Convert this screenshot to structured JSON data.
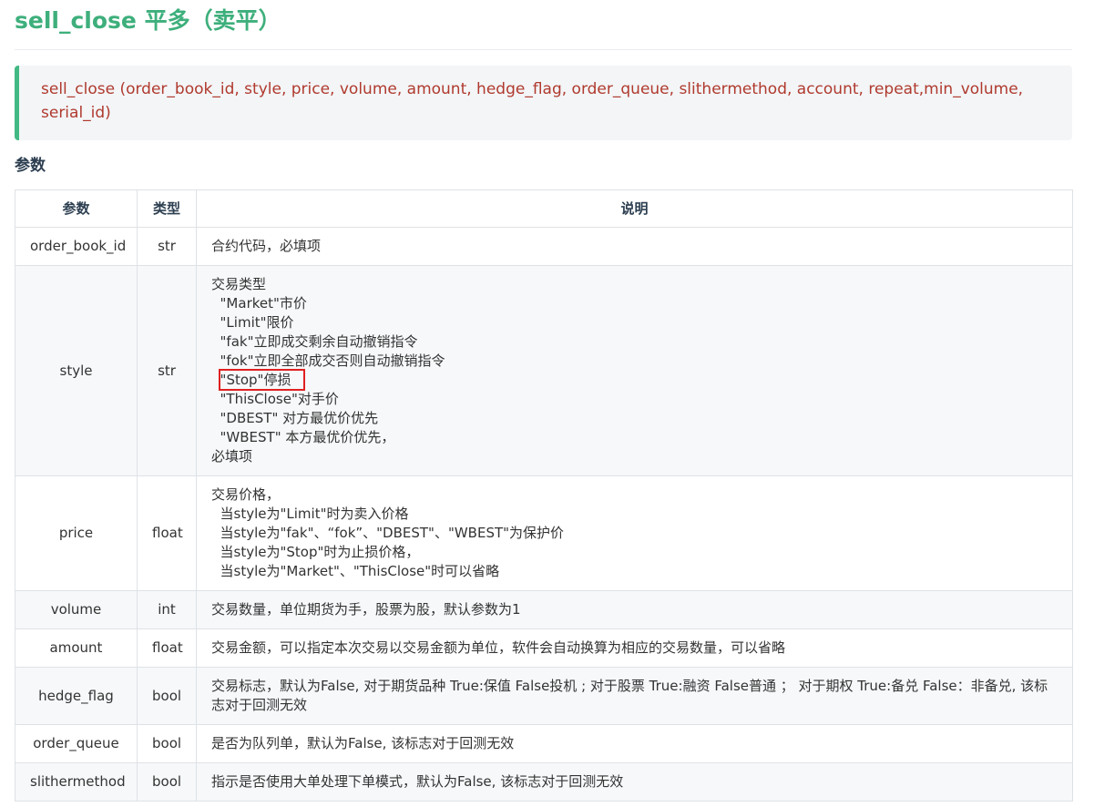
{
  "title": "sell_close 平多（卖平）",
  "signature": "sell_close (order_book_id, style, price, volume, amount, hedge_flag, order_queue, slithermethod, account, repeat,min_volume, serial_id)",
  "params_heading": "参数",
  "table": {
    "headers": [
      "参数",
      "类型",
      "说明"
    ],
    "rows": [
      {
        "name": "order_book_id",
        "type": "str",
        "desc": [
          "合约代码，必填项"
        ]
      },
      {
        "name": "style",
        "type": "str",
        "desc": [
          "交易类型",
          "  \"Market\"市价",
          "  \"Limit\"限价",
          "  \"fak\"立即成交剩余自动撤销指令",
          "  \"fok\"立即全部成交否则自动撤销指令",
          "  \"Stop\"停损",
          "  \"ThisClose\"对手价",
          "  \"DBEST\" 对方最优价优先",
          "  \"WBEST\" 本方最优价优先，",
          "必填项"
        ]
      },
      {
        "name": "price",
        "type": "float",
        "desc": [
          "交易价格，",
          "  当style为\"Limit\"时为卖入价格",
          "  当style为\"fak\"、“fok”、\"DBEST\"、\"WBEST\"为保护价",
          "  当style为\"Stop\"时为止损价格，",
          "  当style为\"Market\"、\"ThisClose\"时可以省略"
        ]
      },
      {
        "name": "volume",
        "type": "int",
        "desc": [
          "交易数量，单位期货为手，股票为股，默认参数为1"
        ]
      },
      {
        "name": "amount",
        "type": "float",
        "desc": [
          "交易金额，可以指定本次交易以交易金额为单位，软件会自动换算为相应的交易数量，可以省略"
        ]
      },
      {
        "name": "hedge_flag",
        "type": "bool",
        "desc": [
          "交易标志，默认为False, 对于期货品种 True:保值 False投机 ; 对于股票 True:融资 False普通 ； 对于期权 True:备兑 False：非备兑, 该标志对于回测无效"
        ]
      },
      {
        "name": "order_queue",
        "type": "bool",
        "desc": [
          "是否为队列单，默认为False, 该标志对于回测无效"
        ]
      },
      {
        "name": "slithermethod",
        "type": "bool",
        "desc": [
          "指示是否使用大单处理下单模式，默认为False, 该标志对于回测无效"
        ]
      }
    ]
  },
  "highlight_color": "#e02020",
  "accent_color": "#3eaf7c"
}
